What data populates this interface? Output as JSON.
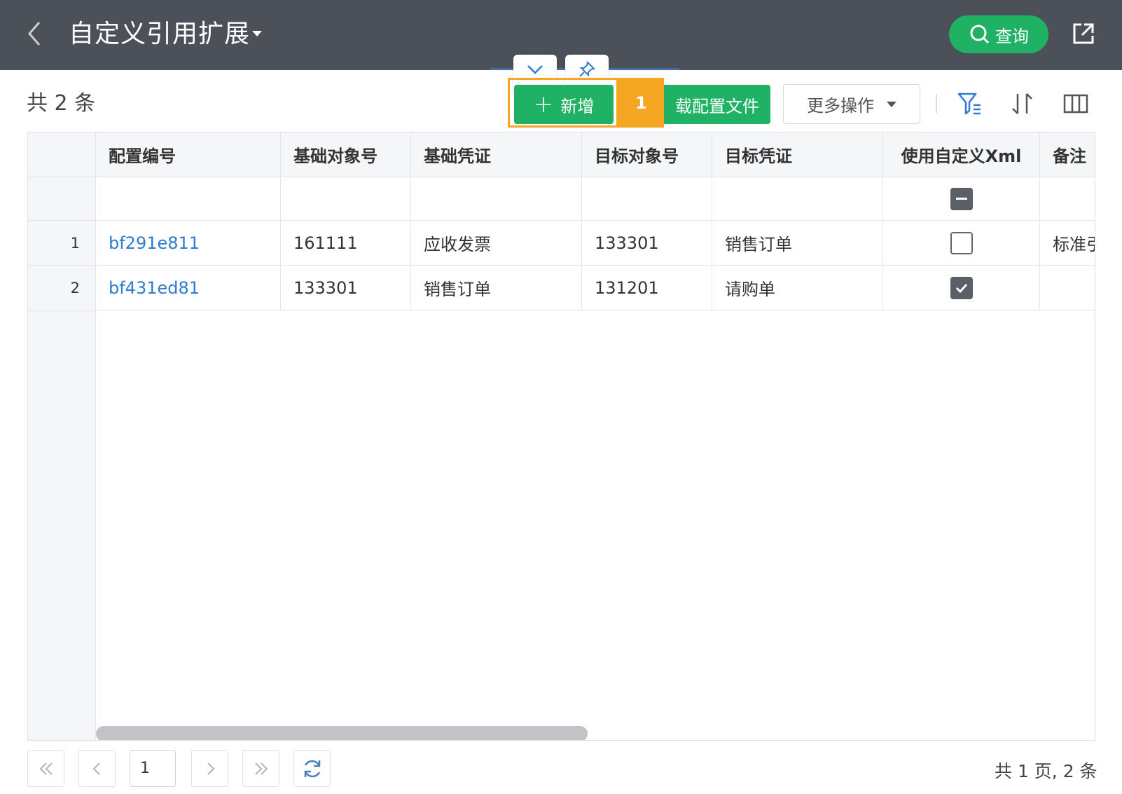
{
  "header": {
    "title": "自定义引用扩展",
    "query_label": "查询"
  },
  "toolbar": {
    "count_text": "共 2 条",
    "add_label": "新增",
    "download_label": "载配置文件",
    "more_label": "更多操作",
    "callout_number": "1"
  },
  "table": {
    "columns": [
      "配置编号",
      "基础对象号",
      "基础凭证",
      "目标对象号",
      "目标凭证",
      "使用自定义Xml",
      "备注"
    ],
    "rows": [
      {
        "index": "1",
        "config_no": "bf291e811",
        "base_obj": "161111",
        "base_doc": "应收发票",
        "target_obj": "133301",
        "target_doc": "销售订单",
        "custom_xml": false,
        "remark": "标准引"
      },
      {
        "index": "2",
        "config_no": "bf431ed81",
        "base_obj": "133301",
        "base_doc": "销售订单",
        "target_obj": "131201",
        "target_doc": "请购单",
        "custom_xml": true,
        "remark": ""
      }
    ]
  },
  "pager": {
    "current_page": "1",
    "info": "共 1 页, 2 条"
  },
  "colors": {
    "header_bg": "#4c5159",
    "primary_green": "#1fb264",
    "highlight_orange": "#f5a623",
    "link_blue": "#2f7bd0"
  }
}
